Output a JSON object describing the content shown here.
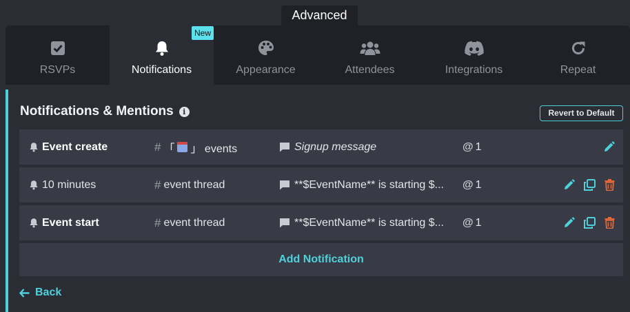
{
  "header": {
    "title": "Advanced"
  },
  "tabs": [
    {
      "label": "RSVPs",
      "icon": "checkbox-icon"
    },
    {
      "label": "Notifications",
      "icon": "bell-icon",
      "badge": "New",
      "active": true
    },
    {
      "label": "Appearance",
      "icon": "palette-icon"
    },
    {
      "label": "Attendees",
      "icon": "users-icon"
    },
    {
      "label": "Integrations",
      "icon": "discord-icon"
    },
    {
      "label": "Repeat",
      "icon": "redo-icon"
    }
  ],
  "panel": {
    "title": "Notifications & Mentions",
    "revert_label": "Revert to Default",
    "add_label": "Add Notification",
    "back_label": "Back"
  },
  "notifications": [
    {
      "name": "Event create",
      "channel_prefix": "「",
      "channel_suffix": "」 events",
      "message": "Signup message",
      "mentions": "1"
    },
    {
      "name": "10 minutes",
      "channel": "event thread",
      "message": "**$EventName** is starting $...",
      "mentions": "1"
    },
    {
      "name": "Event start",
      "channel": "event thread",
      "message": "**$EventName** is starting $...",
      "mentions": "1"
    }
  ],
  "colors": {
    "accent": "#4fd1dc",
    "danger": "#e0683a",
    "background": "#2b2d35",
    "row": "#383b45"
  }
}
